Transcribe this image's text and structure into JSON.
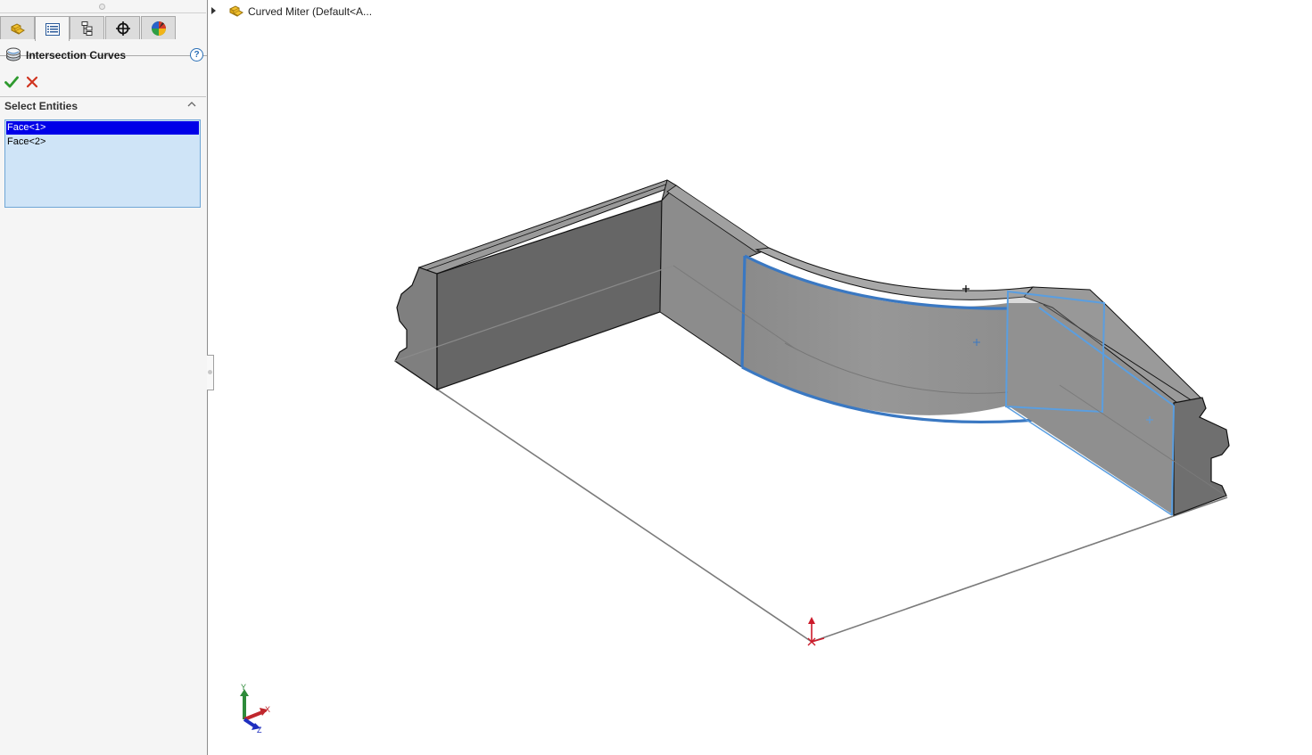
{
  "panel": {
    "tabs": [
      {
        "name": "feature-manager",
        "icon": "part-icon",
        "active": false
      },
      {
        "name": "property-manager",
        "icon": "property-manager-icon",
        "active": true
      },
      {
        "name": "configuration-manager",
        "icon": "configuration-icon",
        "active": false
      },
      {
        "name": "dimxpert-manager",
        "icon": "crosshair-icon",
        "active": false
      },
      {
        "name": "display-manager",
        "icon": "appearance-icon",
        "active": false
      }
    ],
    "title": "Intersection Curves",
    "help_icon": "?",
    "ok_icon": "checkmark-icon",
    "cancel_icon": "x-icon",
    "section": {
      "title": "Select Entities",
      "collapsed": false,
      "items": [
        {
          "label": "Face<1>",
          "selected": true
        },
        {
          "label": "Face<2>",
          "selected": false
        }
      ]
    }
  },
  "tree": {
    "label": "Curved Miter  (Default<A..."
  },
  "triad": {
    "axes": [
      "X",
      "Y",
      "Z"
    ],
    "colors": {
      "x": "#c0272d",
      "y": "#2e8b3a",
      "z": "#1f2fbf"
    }
  },
  "colors": {
    "selection_blue": "#3a78c2",
    "list_selected": "#0000e8",
    "list_bg": "#cfe4f7",
    "model_gray": "#8a8a8a"
  }
}
